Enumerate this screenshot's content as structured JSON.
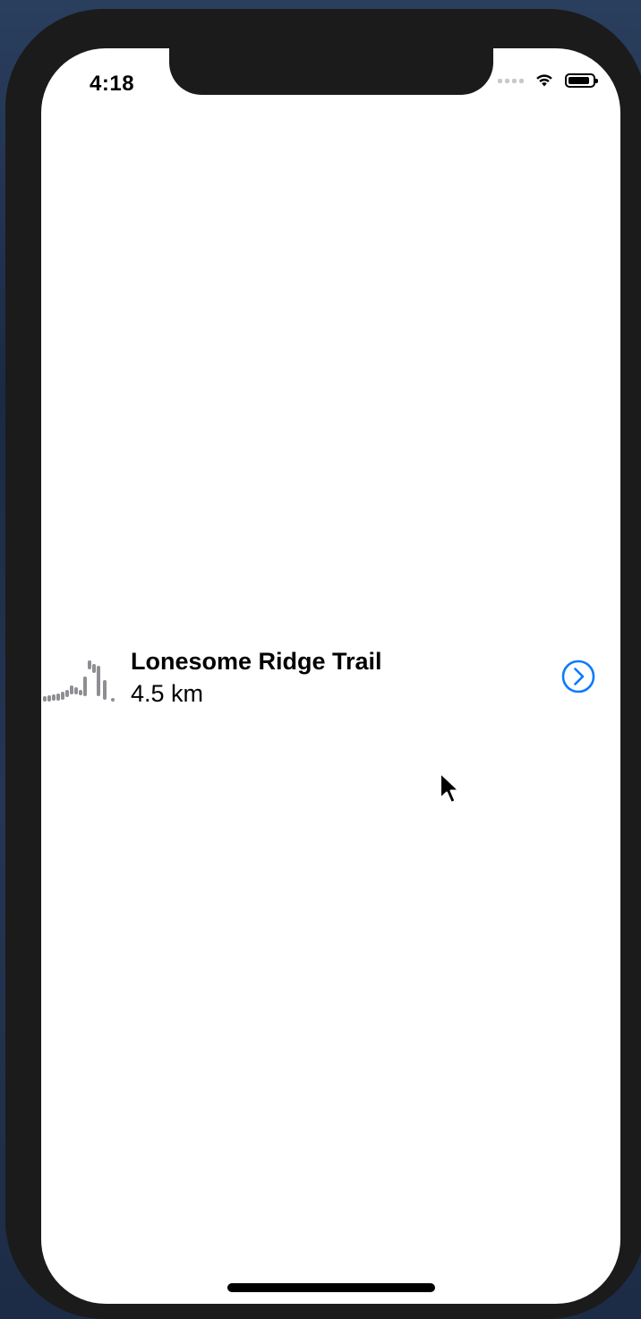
{
  "status_bar": {
    "time": "4:18",
    "battery_level": 0.9
  },
  "hike": {
    "name": "Lonesome Ridge Trail",
    "distance": "4.5 km",
    "graph_icon": "elevation-graph-icon",
    "detail_icon": "chevron-right-circle-icon"
  },
  "colors": {
    "accent": "#0a7aff",
    "graph": "#8e8e93",
    "text": "#000000",
    "background": "#ffffff"
  }
}
